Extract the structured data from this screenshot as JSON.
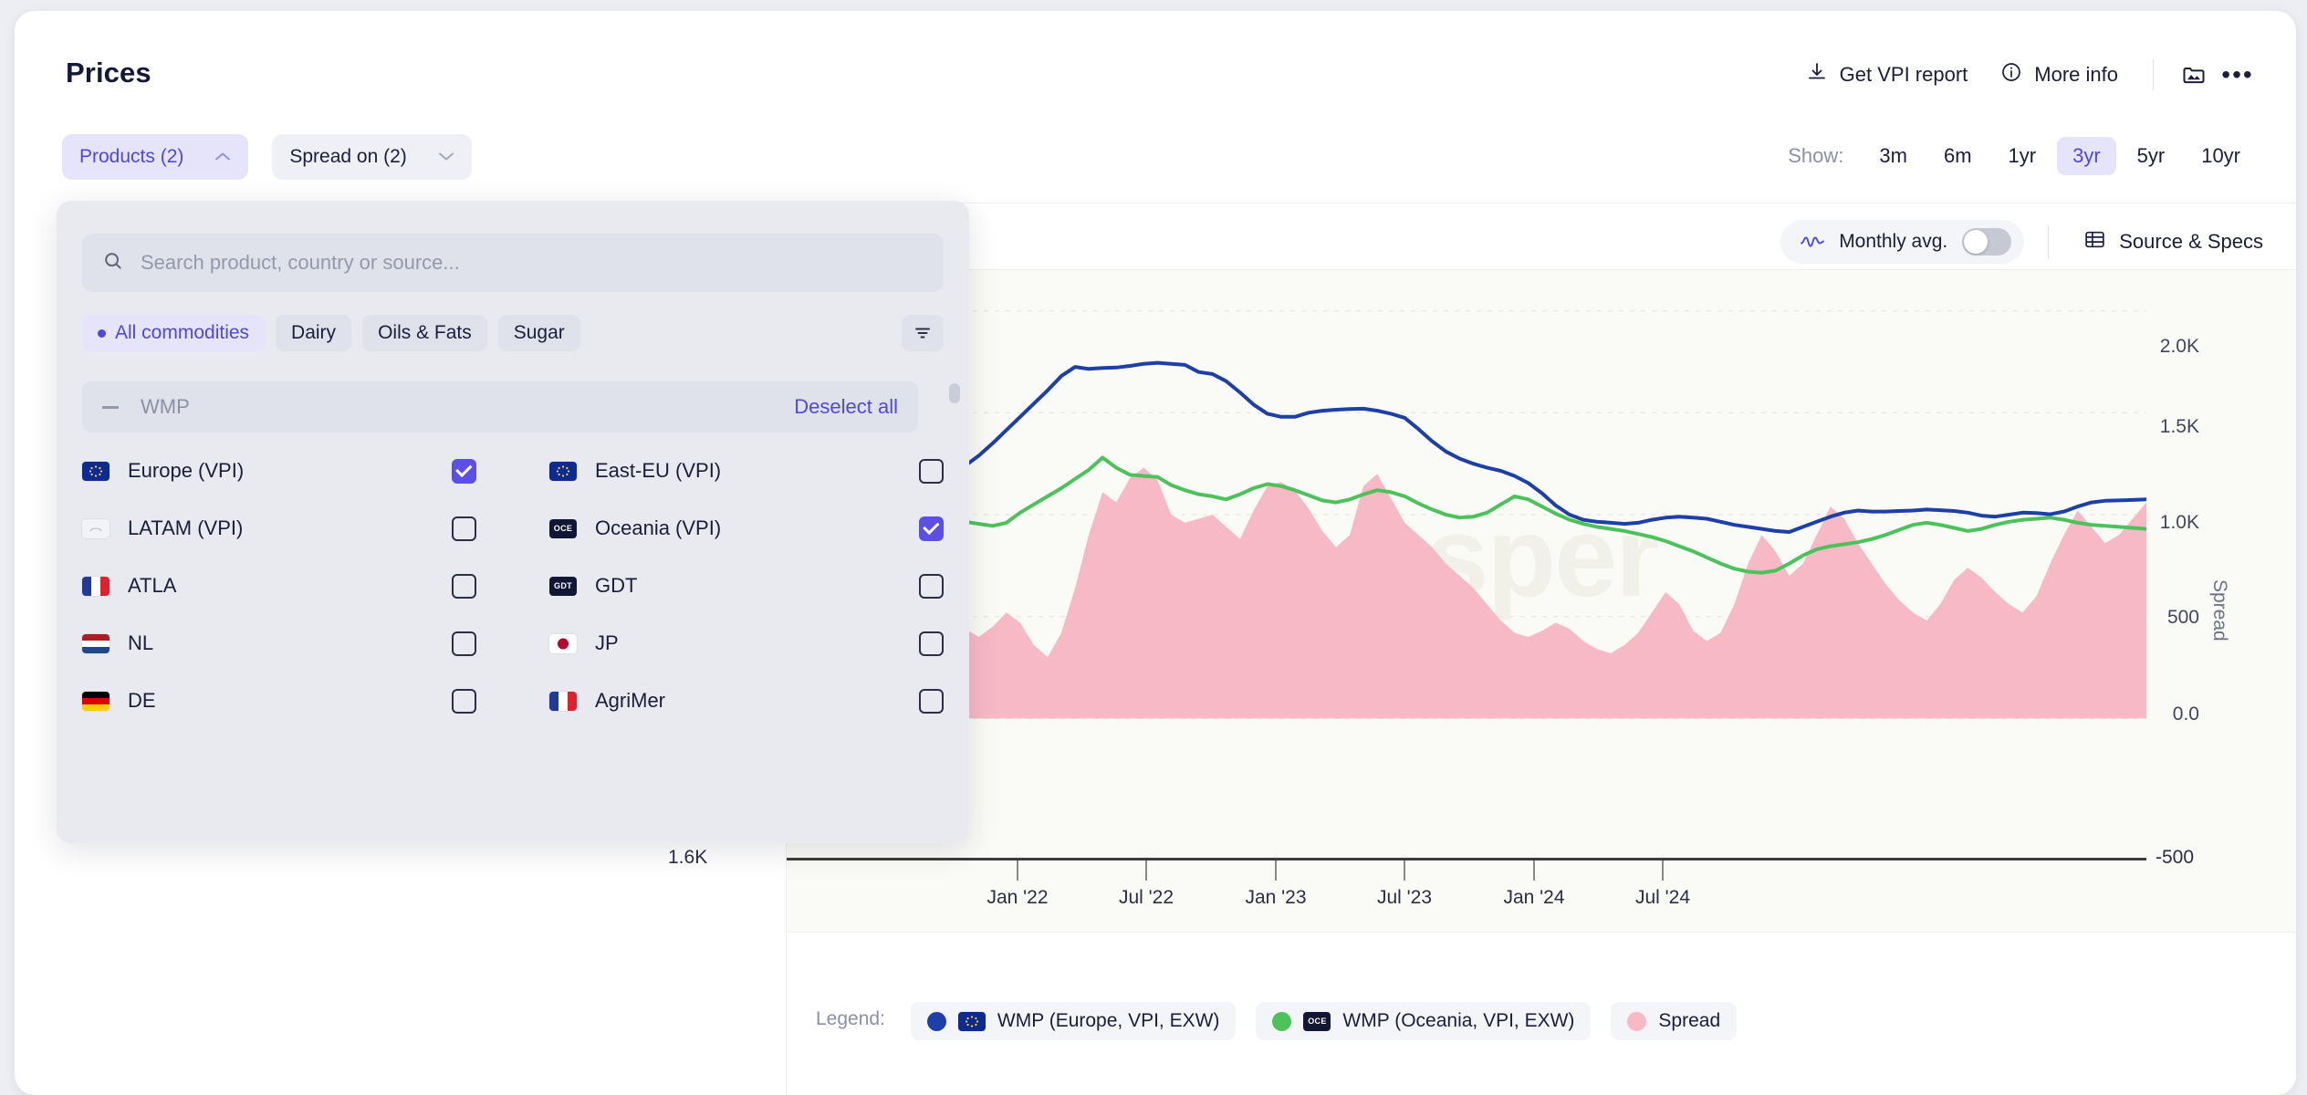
{
  "header": {
    "title": "Prices",
    "actions": [
      {
        "label": "Get VPI report",
        "icon": "download-icon"
      },
      {
        "label": "More info",
        "icon": "info-icon"
      }
    ],
    "gallery_icon": "image-folder-icon",
    "overflow_icon": "more-horizontal-icon"
  },
  "filters": {
    "products": {
      "label": "Products (2)",
      "open": true,
      "chevron": "chevron-up-icon"
    },
    "spread_on": {
      "label": "Spread on (2)",
      "open": false,
      "chevron": "chevron-down-icon"
    }
  },
  "time_range": {
    "label": "Show:",
    "options": [
      "3m",
      "6m",
      "1yr",
      "3yr",
      "5yr",
      "10yr"
    ],
    "selected": "3yr"
  },
  "chart_toolbar": {
    "monthly_avg_label": "Monthly avg.",
    "monthly_avg_on": false,
    "wave_icon": "wave-icon",
    "source_specs_label": "Source & Specs",
    "table_icon": "table-icon"
  },
  "dropdown": {
    "search_placeholder": "Search product, country or source...",
    "search_value": "",
    "search_icon": "search-icon",
    "filter_icon": "filter-icon",
    "categories": [
      {
        "label": "All commodities",
        "selected": true
      },
      {
        "label": "Dairy",
        "selected": false
      },
      {
        "label": "Oils & Fats",
        "selected": false
      },
      {
        "label": "Sugar",
        "selected": false
      }
    ],
    "group": {
      "name": "WMP",
      "deselect_label": "Deselect all",
      "collapse_icon": "minus-icon"
    },
    "items": [
      {
        "label": "Europe (VPI)",
        "checked": true,
        "icon": "eu-flag-icon",
        "col": 0,
        "row": 0
      },
      {
        "label": "East-EU (VPI)",
        "checked": false,
        "icon": "eu-flag-icon",
        "col": 1,
        "row": 0
      },
      {
        "label": "LATAM (VPI)",
        "checked": false,
        "icon": "latam-flag-icon",
        "col": 0,
        "row": 1
      },
      {
        "label": "Oceania (VPI)",
        "checked": true,
        "icon": "oce-badge-icon",
        "col": 1,
        "row": 1
      },
      {
        "label": "ATLA",
        "checked": false,
        "icon": "fr-flag-icon",
        "col": 0,
        "row": 2
      },
      {
        "label": "GDT",
        "checked": false,
        "icon": "gdt-badge-icon",
        "col": 1,
        "row": 2
      },
      {
        "label": "NL",
        "checked": false,
        "icon": "nl-flag-icon",
        "col": 0,
        "row": 3
      },
      {
        "label": "JP",
        "checked": false,
        "icon": "jp-flag-icon",
        "col": 1,
        "row": 3
      },
      {
        "label": "DE",
        "checked": false,
        "icon": "de-flag-icon",
        "col": 0,
        "row": 4
      },
      {
        "label": "AgriMer",
        "checked": false,
        "icon": "fr-flag-icon",
        "col": 1,
        "row": 4
      }
    ]
  },
  "legend": {
    "label": "Legend:",
    "entries": [
      {
        "label": "WMP (Europe, VPI, EXW)",
        "color": "#1D3FA8",
        "icon": "eu-flag-icon"
      },
      {
        "label": "WMP (Oceania, VPI, EXW)",
        "color": "#4CC35A",
        "icon": "oce-badge-icon"
      },
      {
        "label": "Spread",
        "color": "#F7B9C4",
        "icon": "none"
      }
    ]
  },
  "watermark": "sper",
  "chart_data": {
    "type": "line",
    "title": "",
    "xlabel": "",
    "ylabel": "",
    "y2label": "Spread",
    "grid": true,
    "legend_position": "bottom",
    "x_tick_labels": [
      "Jan '22",
      "Jul '22",
      "Jan '23",
      "Jul '23",
      "Jan '24",
      "Jul '24"
    ],
    "x_left_label": "1.6K",
    "x_right_label": "-500",
    "y_right_ticks": [
      "2.0K",
      "1.5K",
      "1.0K",
      "500",
      "0.0",
      "-500"
    ],
    "y_right_values": [
      2000,
      1500,
      1000,
      500,
      0,
      -500
    ],
    "ylim": [
      -500,
      2200
    ],
    "series": [
      {
        "name": "WMP (Europe, VPI, EXW)",
        "color": "#1D3FA8",
        "type": "line",
        "values": [
          845,
          850,
          880,
          915,
          950,
          985,
          1015,
          1045,
          1095,
          1145,
          1190,
          1225,
          1235,
          1240,
          1290,
          1350,
          1415,
          1480,
          1545,
          1610,
          1680,
          1725,
          1715,
          1720,
          1722,
          1730,
          1740,
          1745,
          1740,
          1735,
          1700,
          1690,
          1655,
          1600,
          1540,
          1495,
          1480,
          1480,
          1500,
          1510,
          1515,
          1518,
          1520,
          1510,
          1495,
          1475,
          1420,
          1360,
          1310,
          1275,
          1250,
          1230,
          1215,
          1190,
          1155,
          1105,
          1045,
          1000,
          975,
          965,
          960,
          955,
          960,
          975,
          985,
          990,
          985,
          980,
          965,
          950,
          940,
          930,
          920,
          915,
          940,
          965,
          990,
          1010,
          1020,
          1015,
          1015,
          1018,
          1020,
          1025,
          1022,
          1018,
          1010,
          995,
          990,
          1000,
          1010,
          1008,
          1002,
          1015,
          1040,
          1060,
          1068,
          1070,
          1072,
          1075
        ]
      },
      {
        "name": "WMP (Oceania, VPI, EXW)",
        "color": "#4CC35A",
        "type": "line",
        "values": [
          770,
          790,
          830,
          860,
          875,
          885,
          890,
          895,
          900,
          910,
          930,
          950,
          960,
          965,
          955,
          945,
          960,
          1010,
          1050,
          1090,
          1130,
          1175,
          1220,
          1280,
          1230,
          1195,
          1190,
          1185,
          1145,
          1120,
          1100,
          1090,
          1075,
          1100,
          1130,
          1150,
          1140,
          1120,
          1095,
          1070,
          1060,
          1075,
          1100,
          1120,
          1110,
          1090,
          1055,
          1025,
          1000,
          985,
          990,
          1010,
          1050,
          1090,
          1075,
          1040,
          1005,
          975,
          955,
          940,
          930,
          920,
          905,
          890,
          870,
          845,
          820,
          790,
          760,
          735,
          720,
          715,
          725,
          760,
          800,
          830,
          845,
          855,
          865,
          880,
          900,
          925,
          950,
          960,
          950,
          935,
          920,
          930,
          950,
          965,
          975,
          980,
          985,
          975,
          960,
          950,
          945,
          940,
          935,
          930
        ]
      }
    ],
    "area_series": {
      "name": "Spread",
      "color": "#F7B9C4",
      "type": "area",
      "values": [
        60,
        75,
        55,
        90,
        110,
        120,
        95,
        130,
        180,
        250,
        330,
        420,
        460,
        440,
        400,
        450,
        520,
        470,
        360,
        300,
        420,
        640,
        900,
        1110,
        1060,
        1180,
        1230,
        1170,
        1000,
        960,
        980,
        1000,
        940,
        880,
        1020,
        1140,
        1160,
        1120,
        1030,
        920,
        840,
        900,
        1140,
        1200,
        1080,
        960,
        900,
        840,
        760,
        700,
        640,
        560,
        480,
        420,
        400,
        430,
        470,
        440,
        380,
        340,
        320,
        360,
        420,
        520,
        620,
        560,
        430,
        380,
        420,
        560,
        760,
        900,
        820,
        700,
        760,
        900,
        1040,
        980,
        860,
        760,
        660,
        580,
        520,
        480,
        560,
        680,
        740,
        690,
        620,
        560,
        520,
        600,
        760,
        900,
        1020,
        940,
        860,
        900,
        980,
        1060
      ]
    }
  }
}
